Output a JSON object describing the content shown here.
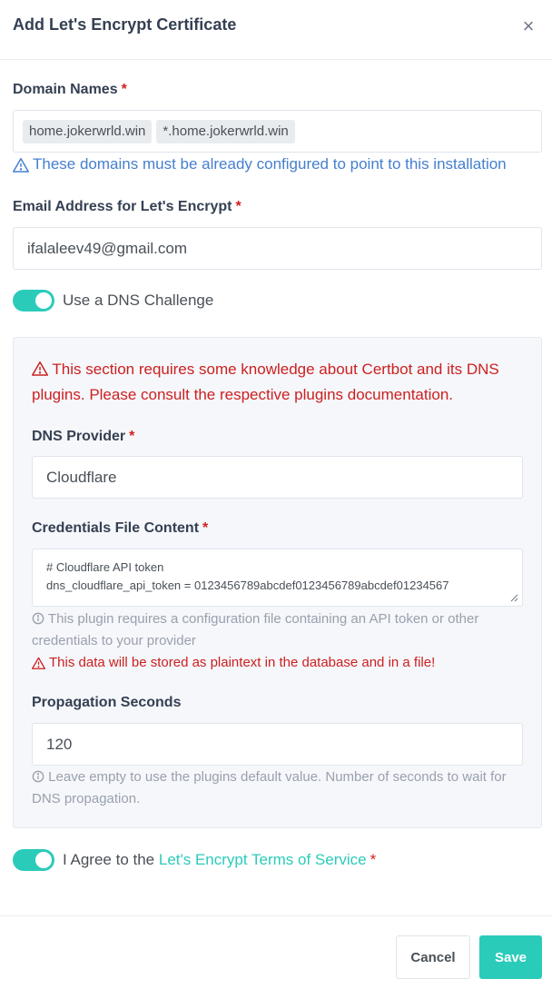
{
  "modal": {
    "title": "Add Let's Encrypt Certificate",
    "close_glyph": "×"
  },
  "domain_names": {
    "label": "Domain Names",
    "required_mark": "*",
    "tags": [
      "home.jokerwrld.win",
      "*.home.jokerwrld.win"
    ],
    "hint": "These domains must be already configured to point to this installation"
  },
  "email": {
    "label": "Email Address for Let's Encrypt",
    "required_mark": "*",
    "value": "ifalaleev49@gmail.com"
  },
  "dns_challenge": {
    "label": "Use a DNS Challenge",
    "enabled": true
  },
  "dns_section": {
    "warning": "This section requires some knowledge about Certbot and its DNS plugins. Please consult the respective plugins documentation.",
    "provider": {
      "label": "DNS Provider",
      "required_mark": "*",
      "value": "Cloudflare"
    },
    "credentials": {
      "label": "Credentials File Content",
      "required_mark": "*",
      "line1": "# Cloudflare API token",
      "line2": "dns_cloudflare_api_token = 0123456789abcdef0123456789abcdef01234567",
      "info": "This plugin requires a configuration file containing an API token or other credentials to your provider",
      "warning": "This data will be stored as plaintext in the database and in a file!"
    },
    "propagation": {
      "label": "Propagation Seconds",
      "value": "120",
      "info": "Leave empty to use the plugins default value. Number of seconds to wait for DNS propagation."
    }
  },
  "agree": {
    "prefix": "I Agree to the ",
    "link": "Let's Encrypt Terms of Service",
    "required_mark": "*",
    "enabled": true
  },
  "footer": {
    "cancel_label": "Cancel",
    "save_label": "Save"
  },
  "colors": {
    "accent": "#2bcbba",
    "danger": "#cd201f",
    "info": "#467fcf",
    "muted": "#9aa0ac"
  }
}
